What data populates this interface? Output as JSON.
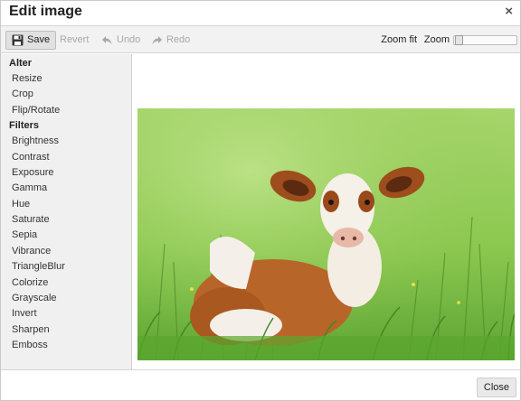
{
  "dialog": {
    "title": "Edit image",
    "close_glyph": "×"
  },
  "toolbar": {
    "save_label": "Save",
    "save_icon": "floppy-disk-icon",
    "revert_label": "Revert",
    "undo_label": "Undo",
    "undo_icon": "undo-arrow-icon",
    "redo_label": "Redo",
    "redo_icon": "redo-arrow-icon",
    "zoom_fit_label": "Zoom fit",
    "zoom_label": "Zoom",
    "zoom_level": 0.02
  },
  "sidebar": {
    "alter_heading": "Alter",
    "alter_items": [
      "Resize",
      "Crop",
      "Flip/Rotate"
    ],
    "filters_heading": "Filters",
    "filter_items": [
      "Brightness",
      "Contrast",
      "Exposure",
      "Gamma",
      "Hue",
      "Saturate",
      "Sepia",
      "Vibrance",
      "TriangleBlur",
      "Colorize",
      "Grayscale",
      "Invert",
      "Sharpen",
      "Emboss"
    ]
  },
  "canvas": {
    "image_subject": "brown-and-white calf lying in green grass"
  },
  "footer": {
    "close_label": "Close"
  },
  "colors": {
    "toolbar_bg": "#f2f2f2",
    "sidebar_bg": "#f0f0f0",
    "disabled_text": "#a8a8a8",
    "grass_green": "#7cc24a"
  }
}
